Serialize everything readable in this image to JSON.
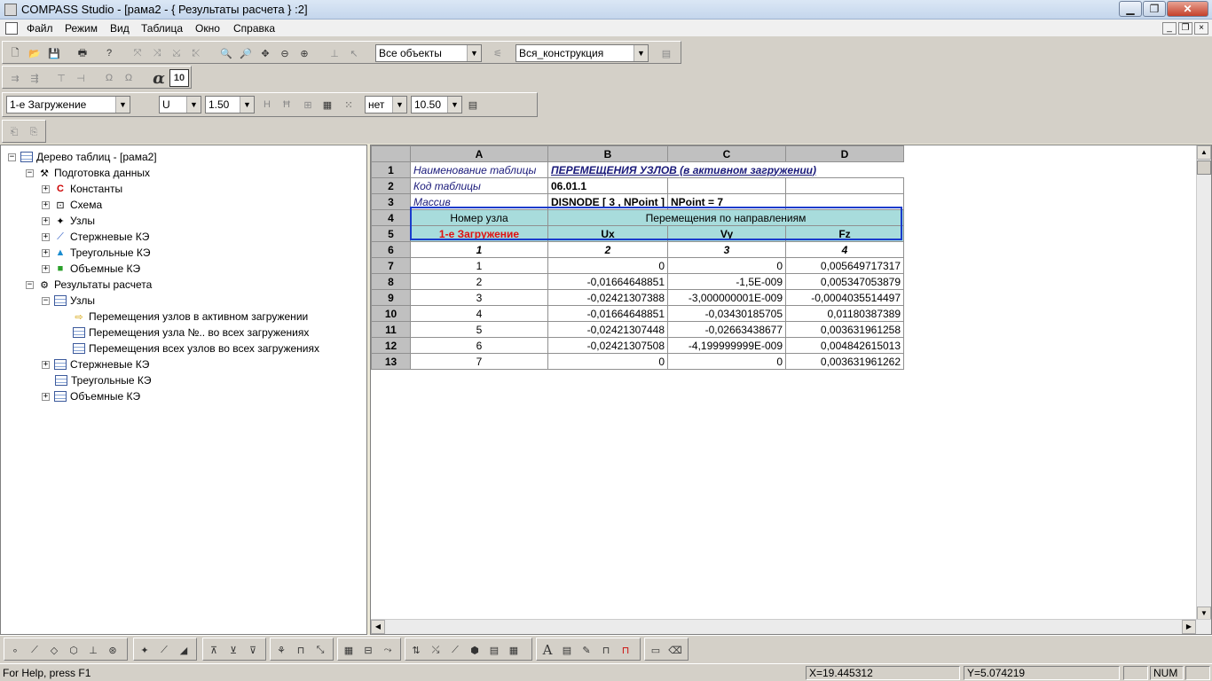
{
  "window": {
    "title": "COMPASS  Studio - [рама2 - { Результаты расчета } :2]",
    "min_label": "▁",
    "max_label": "❐",
    "close_label": "✕"
  },
  "menu": {
    "items": [
      "Файл",
      "Режим",
      "Вид",
      "Таблица",
      "Окно",
      "Справка"
    ],
    "mdi_min": "_",
    "mdi_restore": "❐",
    "mdi_close": "×"
  },
  "toolbar": {
    "objects_select": "Все объекты",
    "construction_select": "Вся_конструкция",
    "alpha_label": "α",
    "font_size_button": "10",
    "loadcase_select": "1-е Загружение",
    "component_select": "U",
    "scale_select": "1.50",
    "option_select": "нет",
    "size_select": "10.50"
  },
  "tree": {
    "root": "Дерево таблиц - [рама2]",
    "prep": "Подготовка данных",
    "prep_items": [
      "Константы",
      "Схема",
      "Узлы",
      "Стержневые КЭ",
      "Треугольные КЭ",
      "Объемные КЭ"
    ],
    "results": "Результаты расчета",
    "nodes": "Узлы",
    "node_items": [
      "Перемещения узлов в активном загружении",
      "Перемещения узла №.. во всех загружениях",
      "Перемещения всех узлов во всех загружениях"
    ],
    "result_items": [
      "Стержневые КЭ",
      "Треугольные КЭ",
      "Объемные КЭ"
    ]
  },
  "sheet": {
    "columns": [
      "A",
      "B",
      "C",
      "D"
    ],
    "r1_label": "Наименование  таблицы",
    "r1_value": "ПЕРЕМЕЩЕНИЯ УЗЛОВ (в активном загружении)",
    "r2_label": "Код таблицы",
    "r2_value": "06.01.1",
    "r3_label": "Массив",
    "r3_b": "DISNODE [ 3 , NPoint ]",
    "r3_c": "NPoint = 7",
    "r4_a": "Номер узла",
    "r4_b": "Перемещения по направлениям",
    "r5_a": "1-е Загружение",
    "r5_b": "Ux",
    "r5_c": "Vy",
    "r5_d": "Fz",
    "r6": [
      "1",
      "2",
      "3",
      "4"
    ],
    "data_rows": [
      {
        "n": "7",
        "a": "1",
        "b": "0",
        "c": "0",
        "d": "0,005649717317"
      },
      {
        "n": "8",
        "a": "2",
        "b": "-0,01664648851",
        "c": "-1,5E-009",
        "d": "0,005347053879"
      },
      {
        "n": "9",
        "a": "3",
        "b": "-0,02421307388",
        "c": "-3,000000001E-009",
        "d": "-0,0004035514497"
      },
      {
        "n": "10",
        "a": "4",
        "b": "-0,01664648851",
        "c": "-0,03430185705",
        "d": "0,01180387389"
      },
      {
        "n": "11",
        "a": "5",
        "b": "-0,02421307448",
        "c": "-0,02663438677",
        "d": "0,003631961258"
      },
      {
        "n": "12",
        "a": "6",
        "b": "-0,02421307508",
        "c": "-4,199999999E-009",
        "d": "0,004842615013"
      },
      {
        "n": "13",
        "a": "7",
        "b": "0",
        "c": "0",
        "d": "0,003631961262"
      }
    ]
  },
  "status": {
    "help": "For Help, press F1",
    "x": "X=19.445312",
    "y": "Y=5.074219",
    "num": "NUM"
  }
}
